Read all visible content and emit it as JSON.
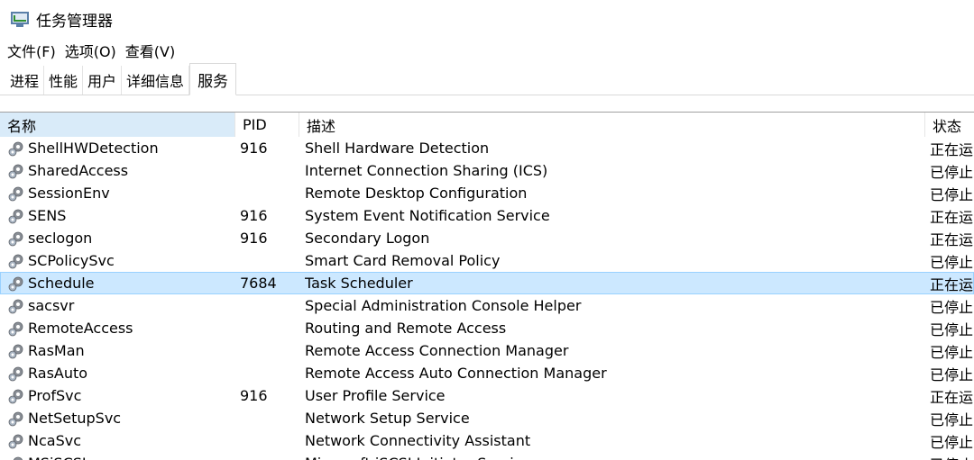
{
  "window": {
    "title": "任务管理器"
  },
  "menu": [
    "文件(F)",
    "选项(O)",
    "查看(V)"
  ],
  "tabs": [
    "进程",
    "性能",
    "用户",
    "详细信息",
    "服务"
  ],
  "active_tab": 4,
  "columns": {
    "name": "名称",
    "pid": "PID",
    "description": "描述",
    "status": "状态"
  },
  "services": [
    {
      "name": "ShellHWDetection",
      "pid": "916",
      "description": "Shell Hardware Detection",
      "status": "正在运"
    },
    {
      "name": "SharedAccess",
      "pid": "",
      "description": "Internet Connection Sharing (ICS)",
      "status": "已停止"
    },
    {
      "name": "SessionEnv",
      "pid": "",
      "description": "Remote Desktop Configuration",
      "status": "已停止"
    },
    {
      "name": "SENS",
      "pid": "916",
      "description": "System Event Notification Service",
      "status": "正在运"
    },
    {
      "name": "seclogon",
      "pid": "916",
      "description": "Secondary Logon",
      "status": "正在运"
    },
    {
      "name": "SCPolicySvc",
      "pid": "",
      "description": "Smart Card Removal Policy",
      "status": "已停止"
    },
    {
      "name": "Schedule",
      "pid": "7684",
      "description": "Task Scheduler",
      "status": "正在运",
      "selected": true
    },
    {
      "name": "sacsvr",
      "pid": "",
      "description": "Special Administration Console Helper",
      "status": "已停止"
    },
    {
      "name": "RemoteAccess",
      "pid": "",
      "description": "Routing and Remote Access",
      "status": "已停止"
    },
    {
      "name": "RasMan",
      "pid": "",
      "description": "Remote Access Connection Manager",
      "status": "已停止"
    },
    {
      "name": "RasAuto",
      "pid": "",
      "description": "Remote Access Auto Connection Manager",
      "status": "已停止"
    },
    {
      "name": "ProfSvc",
      "pid": "916",
      "description": "User Profile Service",
      "status": "正在运"
    },
    {
      "name": "NetSetupSvc",
      "pid": "",
      "description": "Network Setup Service",
      "status": "已停止"
    },
    {
      "name": "NcaSvc",
      "pid": "",
      "description": "Network Connectivity Assistant",
      "status": "已停止"
    },
    {
      "name": "MSiSCSI",
      "pid": "",
      "description": "Microsoft iSCSI Initiator Service",
      "status": "已停止"
    }
  ],
  "icons": {
    "app": "task-manager-icon",
    "service": "service-gear-icon"
  }
}
